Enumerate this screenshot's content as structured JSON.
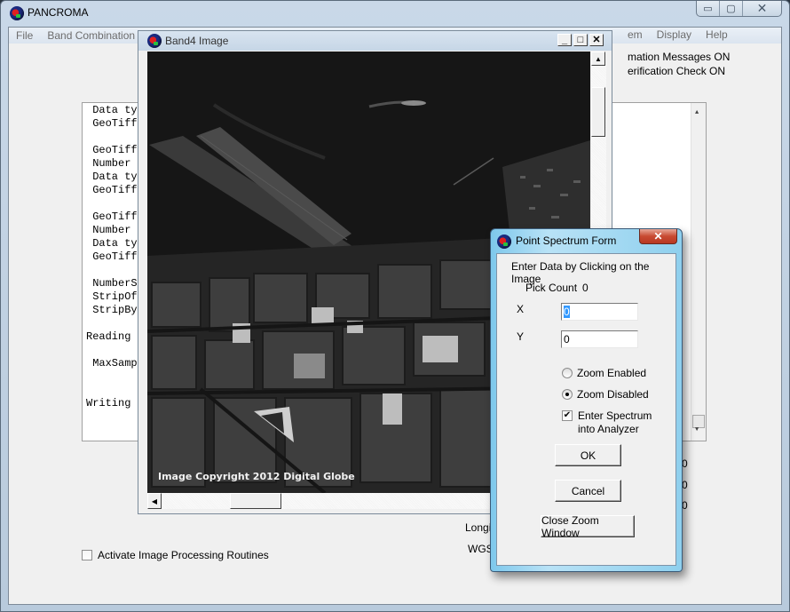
{
  "main_window": {
    "title": "PANCROMA",
    "controls": {
      "minimize": "▭",
      "maximize": "▢",
      "close": "✕"
    }
  },
  "menubar": {
    "left_items": [
      "File",
      "Band Combination"
    ],
    "right_items": [
      "em",
      "Display",
      "Help"
    ]
  },
  "status": {
    "line1": "mation  Messages ON",
    "line2": "erification Check  ON"
  },
  "log": {
    "lines": [
      {
        "text": " Data typ",
        "row": 0
      },
      {
        "text": " GeoTiffD",
        "row": 1
      },
      {
        "text": " GeoTiff ",
        "row": 3
      },
      {
        "text": " Number o",
        "row": 4
      },
      {
        "text": " Data typ",
        "row": 5
      },
      {
        "text": " GeoTiffD",
        "row": 6
      },
      {
        "text": " GeoTiff ",
        "row": 8
      },
      {
        "text": " Number o",
        "row": 9
      },
      {
        "text": " Data typ",
        "row": 10
      },
      {
        "text": " GeoTiffD",
        "row": 11
      },
      {
        "text": " NumberSt",
        "row": 13
      },
      {
        "text": " StripOff",
        "row": 14
      },
      {
        "text": " StripByt",
        "row": 15
      },
      {
        "text": "Reading i",
        "row": 17
      },
      {
        "text": " MaxSampl",
        "row": 19
      },
      {
        "text": "Writing i",
        "row": 22
      }
    ]
  },
  "coords": {
    "longitude_label": "Longit",
    "datum_label": "WGS",
    "values": [
      "0",
      "0",
      "0"
    ]
  },
  "image_processing": {
    "label": "Activate Image Processing Routines",
    "checked": false
  },
  "image_window": {
    "title": "Band4 Image",
    "controls": {
      "minimize": "_",
      "maximize": "□",
      "close": "✕"
    },
    "copyright": "Image Copyright 2012 Digital Globe"
  },
  "point_spectrum_form": {
    "title": "Point Spectrum Form",
    "close": "✕",
    "instruction": "Enter Data by Clicking on the Image",
    "pick_count_label": "Pick Count",
    "pick_count_value": "0",
    "x_label": "X",
    "x_value": "0",
    "y_label": "Y",
    "y_value": "0",
    "zoom_enabled_label": "Zoom Enabled",
    "zoom_disabled_label": "Zoom Disabled",
    "zoom_mode": "disabled",
    "enter_spectrum_label_line1": "Enter Spectrum",
    "enter_spectrum_label_line2": "into Analyzer",
    "enter_spectrum_checked": true,
    "ok_label": "OK",
    "cancel_label": "Cancel",
    "close_zoom_label": "Close Zoom Window"
  }
}
